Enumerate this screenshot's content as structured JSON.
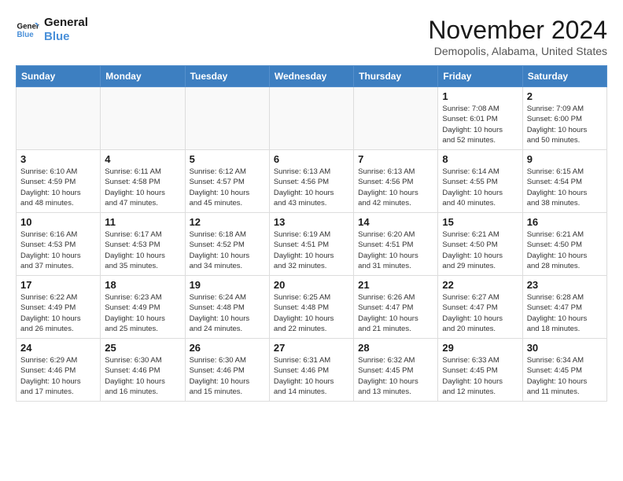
{
  "header": {
    "logo_line1": "General",
    "logo_line2": "Blue",
    "month_title": "November 2024",
    "location": "Demopolis, Alabama, United States"
  },
  "calendar": {
    "days_of_week": [
      "Sunday",
      "Monday",
      "Tuesday",
      "Wednesday",
      "Thursday",
      "Friday",
      "Saturday"
    ],
    "weeks": [
      [
        {
          "day": "",
          "info": ""
        },
        {
          "day": "",
          "info": ""
        },
        {
          "day": "",
          "info": ""
        },
        {
          "day": "",
          "info": ""
        },
        {
          "day": "",
          "info": ""
        },
        {
          "day": "1",
          "info": "Sunrise: 7:08 AM\nSunset: 6:01 PM\nDaylight: 10 hours\nand 52 minutes."
        },
        {
          "day": "2",
          "info": "Sunrise: 7:09 AM\nSunset: 6:00 PM\nDaylight: 10 hours\nand 50 minutes."
        }
      ],
      [
        {
          "day": "3",
          "info": "Sunrise: 6:10 AM\nSunset: 4:59 PM\nDaylight: 10 hours\nand 48 minutes."
        },
        {
          "day": "4",
          "info": "Sunrise: 6:11 AM\nSunset: 4:58 PM\nDaylight: 10 hours\nand 47 minutes."
        },
        {
          "day": "5",
          "info": "Sunrise: 6:12 AM\nSunset: 4:57 PM\nDaylight: 10 hours\nand 45 minutes."
        },
        {
          "day": "6",
          "info": "Sunrise: 6:13 AM\nSunset: 4:56 PM\nDaylight: 10 hours\nand 43 minutes."
        },
        {
          "day": "7",
          "info": "Sunrise: 6:13 AM\nSunset: 4:56 PM\nDaylight: 10 hours\nand 42 minutes."
        },
        {
          "day": "8",
          "info": "Sunrise: 6:14 AM\nSunset: 4:55 PM\nDaylight: 10 hours\nand 40 minutes."
        },
        {
          "day": "9",
          "info": "Sunrise: 6:15 AM\nSunset: 4:54 PM\nDaylight: 10 hours\nand 38 minutes."
        }
      ],
      [
        {
          "day": "10",
          "info": "Sunrise: 6:16 AM\nSunset: 4:53 PM\nDaylight: 10 hours\nand 37 minutes."
        },
        {
          "day": "11",
          "info": "Sunrise: 6:17 AM\nSunset: 4:53 PM\nDaylight: 10 hours\nand 35 minutes."
        },
        {
          "day": "12",
          "info": "Sunrise: 6:18 AM\nSunset: 4:52 PM\nDaylight: 10 hours\nand 34 minutes."
        },
        {
          "day": "13",
          "info": "Sunrise: 6:19 AM\nSunset: 4:51 PM\nDaylight: 10 hours\nand 32 minutes."
        },
        {
          "day": "14",
          "info": "Sunrise: 6:20 AM\nSunset: 4:51 PM\nDaylight: 10 hours\nand 31 minutes."
        },
        {
          "day": "15",
          "info": "Sunrise: 6:21 AM\nSunset: 4:50 PM\nDaylight: 10 hours\nand 29 minutes."
        },
        {
          "day": "16",
          "info": "Sunrise: 6:21 AM\nSunset: 4:50 PM\nDaylight: 10 hours\nand 28 minutes."
        }
      ],
      [
        {
          "day": "17",
          "info": "Sunrise: 6:22 AM\nSunset: 4:49 PM\nDaylight: 10 hours\nand 26 minutes."
        },
        {
          "day": "18",
          "info": "Sunrise: 6:23 AM\nSunset: 4:49 PM\nDaylight: 10 hours\nand 25 minutes."
        },
        {
          "day": "19",
          "info": "Sunrise: 6:24 AM\nSunset: 4:48 PM\nDaylight: 10 hours\nand 24 minutes."
        },
        {
          "day": "20",
          "info": "Sunrise: 6:25 AM\nSunset: 4:48 PM\nDaylight: 10 hours\nand 22 minutes."
        },
        {
          "day": "21",
          "info": "Sunrise: 6:26 AM\nSunset: 4:47 PM\nDaylight: 10 hours\nand 21 minutes."
        },
        {
          "day": "22",
          "info": "Sunrise: 6:27 AM\nSunset: 4:47 PM\nDaylight: 10 hours\nand 20 minutes."
        },
        {
          "day": "23",
          "info": "Sunrise: 6:28 AM\nSunset: 4:47 PM\nDaylight: 10 hours\nand 18 minutes."
        }
      ],
      [
        {
          "day": "24",
          "info": "Sunrise: 6:29 AM\nSunset: 4:46 PM\nDaylight: 10 hours\nand 17 minutes."
        },
        {
          "day": "25",
          "info": "Sunrise: 6:30 AM\nSunset: 4:46 PM\nDaylight: 10 hours\nand 16 minutes."
        },
        {
          "day": "26",
          "info": "Sunrise: 6:30 AM\nSunset: 4:46 PM\nDaylight: 10 hours\nand 15 minutes."
        },
        {
          "day": "27",
          "info": "Sunrise: 6:31 AM\nSunset: 4:46 PM\nDaylight: 10 hours\nand 14 minutes."
        },
        {
          "day": "28",
          "info": "Sunrise: 6:32 AM\nSunset: 4:45 PM\nDaylight: 10 hours\nand 13 minutes."
        },
        {
          "day": "29",
          "info": "Sunrise: 6:33 AM\nSunset: 4:45 PM\nDaylight: 10 hours\nand 12 minutes."
        },
        {
          "day": "30",
          "info": "Sunrise: 6:34 AM\nSunset: 4:45 PM\nDaylight: 10 hours\nand 11 minutes."
        }
      ]
    ]
  }
}
